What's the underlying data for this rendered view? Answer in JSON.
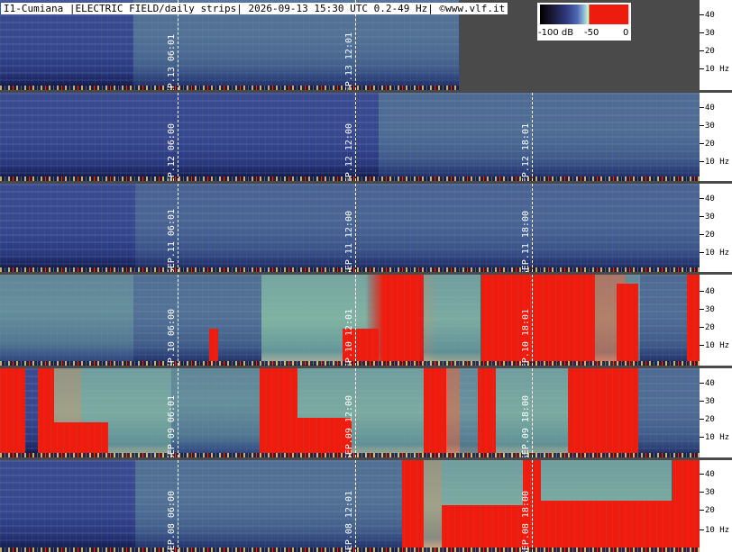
{
  "header": {
    "title": "I1-Cumiana |ELECTRIC FIELD/daily strips| 2026-09-13 15:30 UTC 0.2-49 Hz| ©www.vlf.it"
  },
  "colorbar": {
    "labels": [
      "-100 dB",
      "-50",
      "0"
    ]
  },
  "axis_ticks": [
    "40",
    "30",
    "20",
    "10 Hz"
  ],
  "strips": [
    {
      "markers": [
        "SEP.13 06:01",
        "SEP.13 12:01"
      ]
    },
    {
      "markers": [
        "SEP.12 06:00",
        "SEP.12 12:00",
        "SEP.12 18:01"
      ]
    },
    {
      "markers": [
        "SEP.11 06:01",
        "SEP.11 12:00",
        "SEP.11 18:00"
      ]
    },
    {
      "markers": [
        "SEP.10 06:00",
        "SEP.10 12:01",
        "SEP.10 18:01"
      ]
    },
    {
      "markers": [
        "SEP.09 06:01",
        "SEP.09 12:00",
        "SEP.09 18:00"
      ]
    },
    {
      "markers": [
        "SEP.08 06:00",
        "SEP.08 12:01",
        "SEP.08 18:00"
      ]
    }
  ]
}
